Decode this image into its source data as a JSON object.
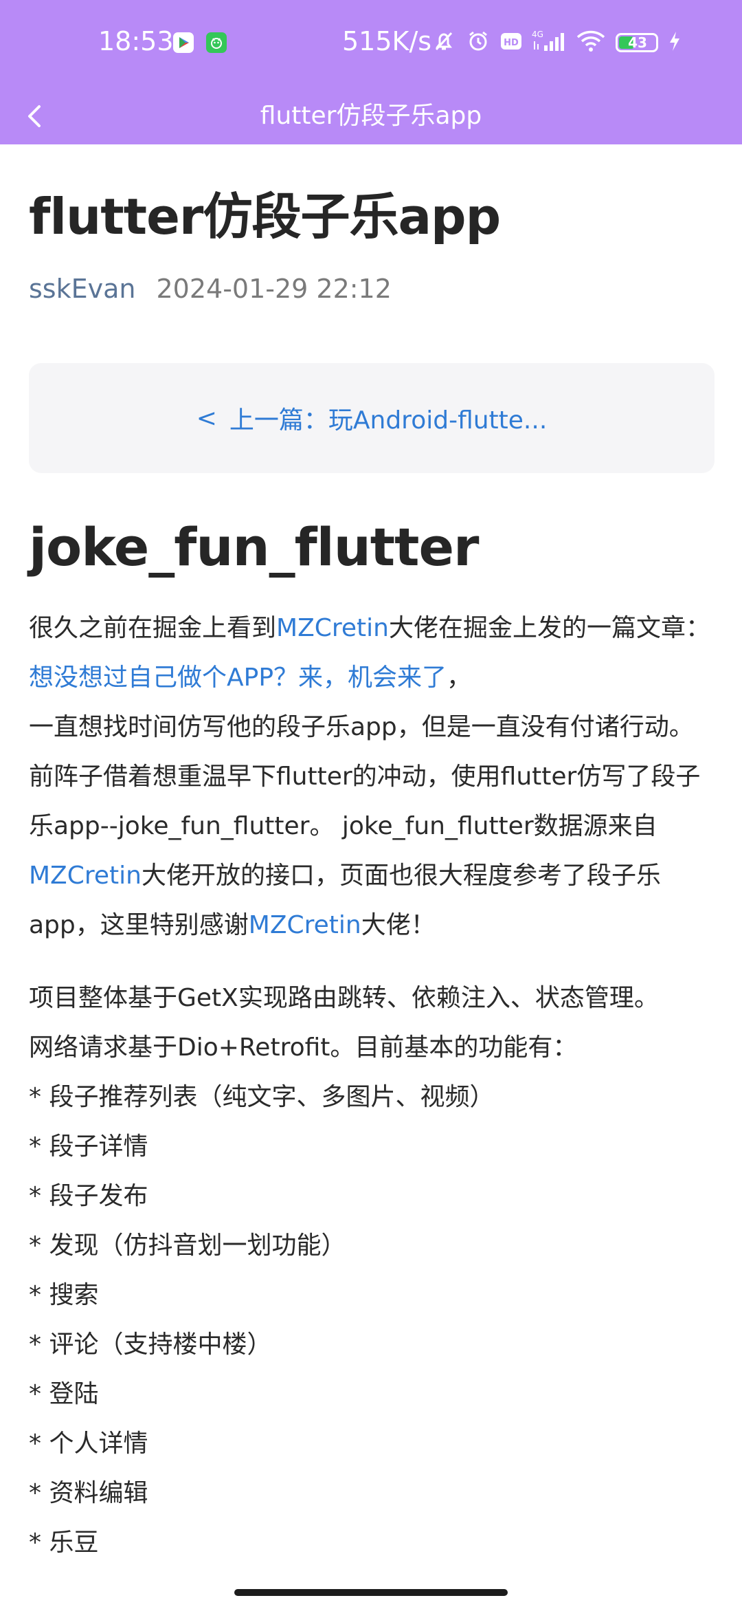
{
  "status_bar": {
    "time": "18:53",
    "network_speed": "515K/s",
    "network_type": "4G",
    "battery_level": "43",
    "icons": [
      "play-store-icon",
      "app-notification-icon",
      "mute-bell-icon",
      "alarm-icon",
      "hd-icon",
      "signal-icon",
      "wifi-icon",
      "battery-icon",
      "charging-icon"
    ]
  },
  "app_bar": {
    "title": "flutter仿段子乐app"
  },
  "article": {
    "title": "flutter仿段子乐app",
    "author": "sskEvan",
    "date": "2024-01-29 22:12",
    "prev_label": "上一篇：玩Android-flutte...",
    "section_heading": "joke_fun_flutter",
    "p1": {
      "t1": "很久之前在掘金上看到",
      "link1": "MZCretin",
      "t2": "大佬在掘金上发的一篇文章：",
      "link2": "想没想过自己做个APP？来，机会来了",
      "t3": "，",
      "t4": "一直想找时间仿写他的段子乐app，但是一直没有付诸行动。前阵子借着想重温早下flutter的冲动，使用flutter仿写了段子乐app--joke_fun_flutter。 joke_fun_flutter数据源来自",
      "link3": "MZCretin",
      "t5": "大佬开放的接口，页面也很大程度参考了段子乐app，这里特别感谢",
      "link4": "MZCretin",
      "t6": "大佬！"
    },
    "p2_line1": "项目整体基于GetX实现路由跳转、依赖注入、状态管理。",
    "p2_line2": "网络请求基于Dio+Retrofit。目前基本的功能有：",
    "features": [
      "* 段子推荐列表（纯文字、多图片、视频）",
      "* 段子详情",
      "* 段子发布",
      "* 发现（仿抖音划一划功能）",
      "* 搜索",
      "* 评论（支持楼中楼）",
      "* 登陆",
      "* 个人详情",
      "* 资料编辑",
      "* 乐豆"
    ]
  },
  "colors": {
    "app_bar": "#b88af7",
    "link": "#2f7bd5",
    "author": "#5a7496",
    "prev_box_bg": "#f5f5f7"
  }
}
